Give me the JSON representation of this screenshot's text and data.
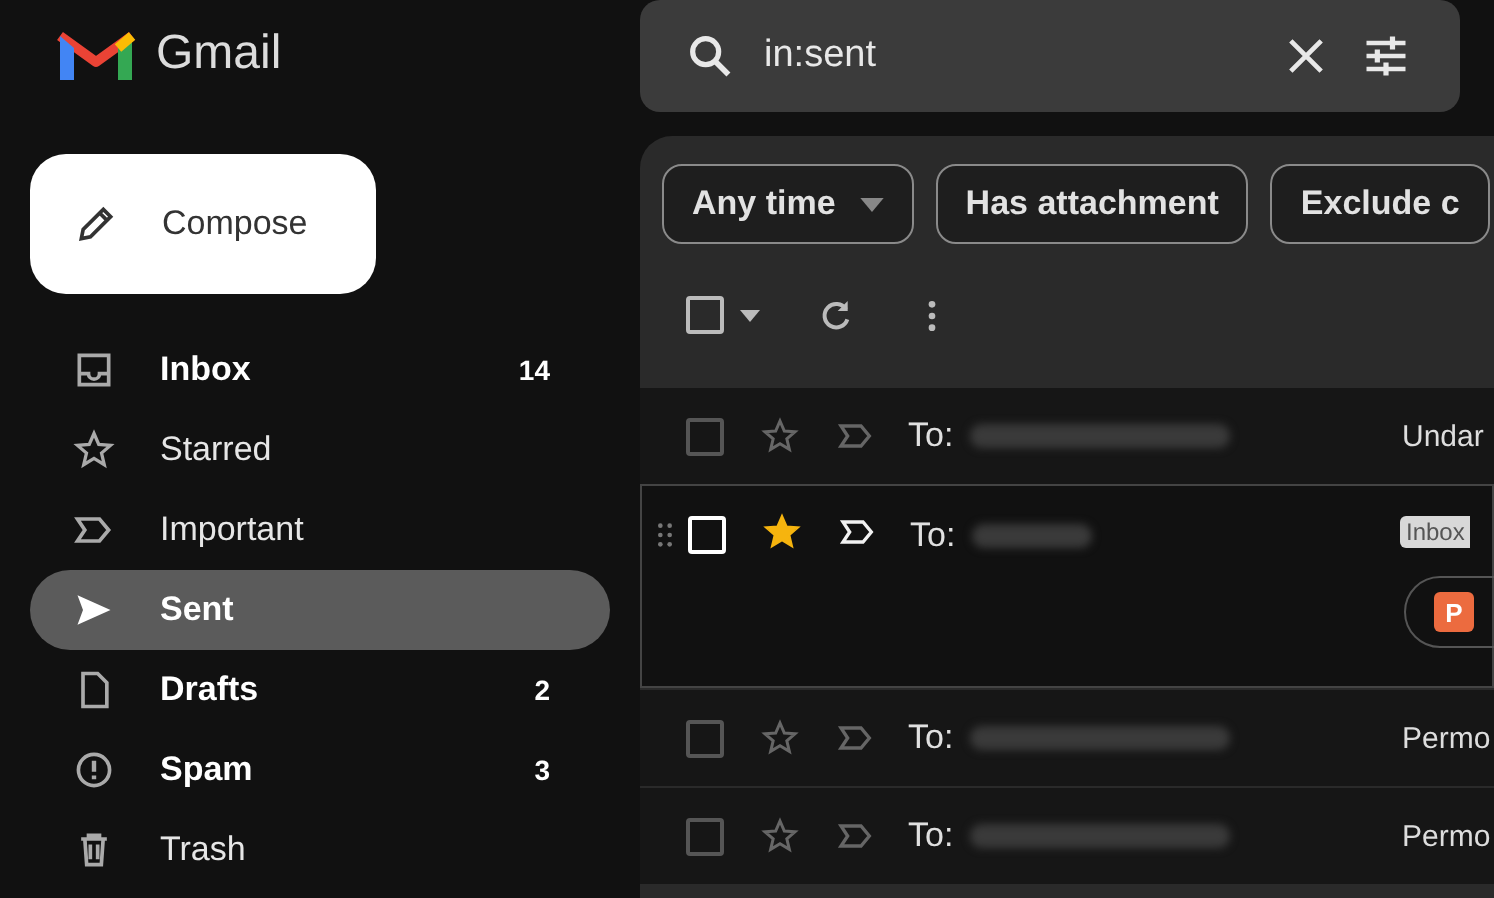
{
  "app": {
    "name": "Gmail"
  },
  "compose": {
    "label": "Compose"
  },
  "sidebar": {
    "items": [
      {
        "kind": "inbox",
        "label": "Inbox",
        "count": "14",
        "bold": true,
        "selected": false
      },
      {
        "kind": "star",
        "label": "Starred",
        "bold": false,
        "selected": false
      },
      {
        "kind": "important",
        "label": "Important",
        "bold": false,
        "selected": false
      },
      {
        "kind": "send",
        "label": "Sent",
        "bold": true,
        "selected": true
      },
      {
        "kind": "draft",
        "label": "Drafts",
        "count": "2",
        "bold": true,
        "selected": false
      },
      {
        "kind": "spam",
        "label": "Spam",
        "count": "3",
        "bold": true,
        "selected": false
      },
      {
        "kind": "trash",
        "label": "Trash",
        "bold": false,
        "selected": false
      }
    ]
  },
  "search": {
    "value": "in:sent"
  },
  "filters": [
    {
      "label": "Any time",
      "dropdown": true
    },
    {
      "label": "Has attachment",
      "dropdown": false
    },
    {
      "label": "Exclude c",
      "dropdown": false
    }
  ],
  "toolbar": {
    "select_all": {
      "checked": false
    }
  },
  "rows": [
    {
      "to": "To:",
      "subject": "Undar",
      "starred": false,
      "important": false,
      "hovered": false
    },
    {
      "to": "To:",
      "tag": "Inbox",
      "attachment": "P",
      "starred": true,
      "important": true,
      "hovered": true
    },
    {
      "to": "To:",
      "subject": "Permo",
      "starred": false,
      "important": false,
      "hovered": false
    },
    {
      "to": "To:",
      "subject": "Permo",
      "starred": false,
      "important": false,
      "hovered": false
    }
  ]
}
